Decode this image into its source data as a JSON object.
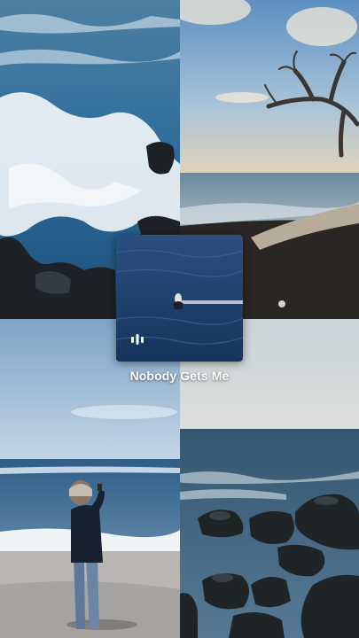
{
  "song": {
    "title": "Nobody Gets Me"
  },
  "icons": {
    "audio": "audio-waveform-icon"
  },
  "colors": {
    "title_text": "#ffffff",
    "ocean_deep": "#1c3f6b",
    "sky": "#8fb3d6"
  }
}
